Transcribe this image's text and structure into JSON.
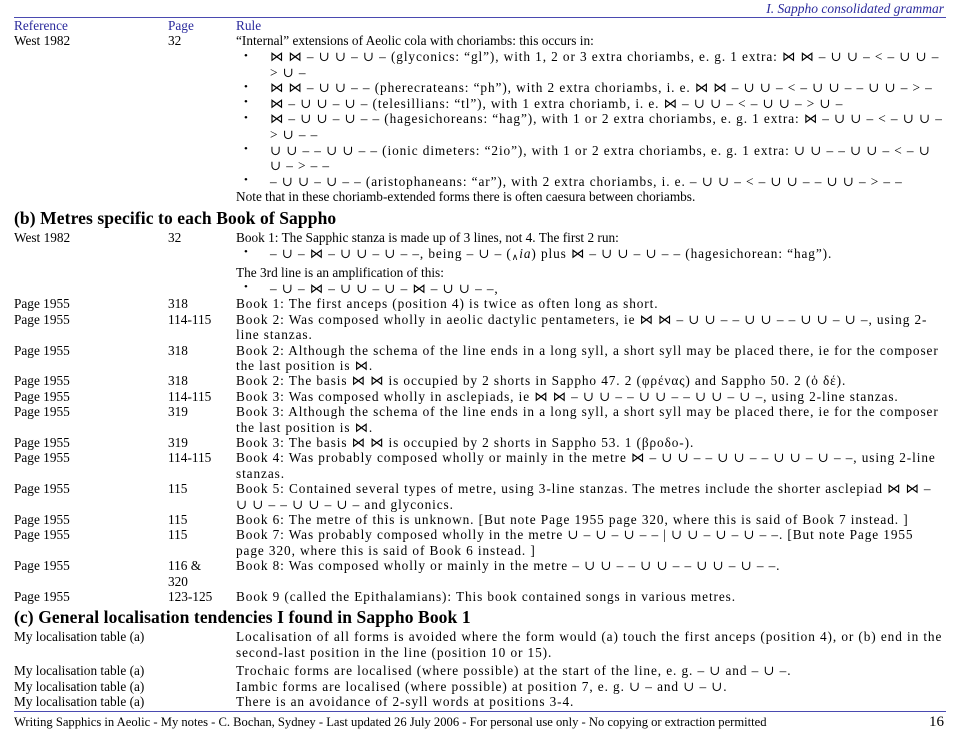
{
  "header": {
    "running_title": "I.  Sappho consolidated grammar",
    "accent_color": "#2a2a9c"
  },
  "table": {
    "columns": {
      "reference": "Reference",
      "page": "Page",
      "rule": "Rule"
    }
  },
  "sections": [
    {
      "id": "section-a-rows",
      "rows": [
        {
          "reference": "West 1982",
          "page": "32",
          "rule_intro": "“Internal” extensions of Aeolic cola with choriambs: this occurs in:",
          "bullets": [
            "⋈ ⋈ – ∪ ∪ – ∪ – (glyconics: “gl”), with 1, 2 or 3 extra choriambs, e. g.  1 extra: ⋈ ⋈ – ∪ ∪ – < – ∪ ∪ – > ∪ –",
            "⋈ ⋈ – ∪ ∪ – – (pherecrateans: “ph”), with 2 extra choriambs,  i. e. ⋈ ⋈ – ∪ ∪ – < – ∪ ∪ – – ∪ ∪ – > –",
            "⋈ – ∪ ∪ – ∪ – (telesillians: “tl”), with 1 extra choriamb, i. e. ⋈ – ∪ ∪ – < – ∪ ∪ – > ∪ –",
            "⋈ – ∪ ∪ – ∪ – – (hagesichoreans: “hag”), with 1 or 2 extra choriambs, e. g.  1 extra: ⋈ – ∪ ∪ – < – ∪ ∪ – > ∪ – –",
            "∪ ∪ – – ∪ ∪ – – (ionic dimeters: “2io”), with 1 or 2 extra choriambs, e. g.  1 extra: ∪ ∪ – – ∪ ∪ – < – ∪ ∪ – > – –",
            "– ∪ ∪ – ∪ – – (aristophaneans: “ar”), with 2 extra choriambs, i. e.  – ∪ ∪ – < – ∪ ∪ – – ∪ ∪ – > – –"
          ],
          "note": "Note that in these choriamb-extended forms there is often caesura between choriambs."
        }
      ]
    }
  ],
  "section_b": {
    "heading": "(b) Metres specific to each Book of Sappho",
    "rows": [
      {
        "reference": "West 1982",
        "page": "32",
        "rule_intro": "Book 1: The Sapphic stanza is made up of 3 lines, not 4.   The first 2 run:",
        "bullet1_pre": "– ∪ – ⋈ – ∪ ∪ – ∪ – –, being – ∪ – (",
        "bullet1_sub": "∧",
        "bullet1_ital": "ia",
        "bullet1_post": ") plus ⋈ – ∪ ∪ – ∪ – – (hagesichorean: “hag”).",
        "mid_text": "The 3rd line is an amplification of this:",
        "bullet2": "– ∪ – ⋈ – ∪ ∪ – ∪ – ⋈ – ∪ ∪ – –,"
      },
      {
        "reference": "Page 1955",
        "page": "318",
        "rule": "Book 1: The first anceps (position 4) is twice as often long as short."
      },
      {
        "reference": "Page 1955",
        "page": "114-115",
        "rule": "Book 2: Was composed wholly in aeolic dactylic pentameters, ie ⋈ ⋈ – ∪ ∪ – – ∪ ∪ – – ∪ ∪ – ∪ –, using 2-line stanzas."
      },
      {
        "reference": "Page 1955",
        "page": "318",
        "rule": "Book 2: Although the schema of the line ends in a long syll, a short syll may be placed there, ie for the composer the last position is ⋈."
      },
      {
        "reference": "Page 1955",
        "page": "318",
        "rule": "Book 2: The basis ⋈ ⋈ is occupied by 2 shorts in Sappho 47. 2 (φρένας) and Sappho 50. 2 (ὁ δέ)."
      },
      {
        "reference": "Page 1955",
        "page": "114-115",
        "rule": "Book 3: Was composed wholly in asclepiads, ie ⋈ ⋈ – ∪ ∪ – – ∪ ∪ – – ∪ ∪ – ∪ –, using 2-line stanzas."
      },
      {
        "reference": "Page 1955",
        "page": "319",
        "rule": "Book 3: Although the schema of the line ends in a long syll, a short syll may be placed there, ie for the composer the last position is ⋈."
      },
      {
        "reference": "Page 1955",
        "page": "319",
        "rule": "Book 3: The basis ⋈ ⋈ is occupied by 2 shorts in Sappho 53. 1 (βροδο-)."
      },
      {
        "reference": "Page 1955",
        "page": "114-115",
        "rule": "Book 4: Was probably composed wholly or mainly in the metre ⋈ – ∪ ∪ – – ∪ ∪ – – ∪ ∪ – ∪ – –, using 2-line stanzas."
      },
      {
        "reference": "Page 1955",
        "page": "115",
        "rule": "Book 5: Contained several types of metre, using 3-line stanzas.   The metres include the shorter asclepiad ⋈ ⋈ – ∪ ∪ – – ∪ ∪ – ∪ – and glyconics."
      },
      {
        "reference": "Page 1955",
        "page": "115",
        "rule": "Book 6: The metre of this is unknown. [But note Page 1955 page 320, where this is said of Book 7 instead. ]"
      },
      {
        "reference": "Page 1955",
        "page": "115",
        "rule": "Book 7: Was probably composed wholly in the metre ∪ – ∪ – ∪ – – | ∪ ∪ – ∪ – ∪ – –. [But note Page 1955 page 320, where this is said of Book 6 instead. ]"
      },
      {
        "reference": "Page 1955",
        "page": "116 &",
        "page2": "320",
        "rule": "Book 8: Was composed wholly or mainly in the metre – ∪ ∪ – – ∪ ∪ – – ∪ ∪ – ∪ – –."
      },
      {
        "reference": "Page 1955",
        "page": "123-125",
        "rule": "Book 9 (called the Epithalamians): This book contained songs in various metres."
      }
    ]
  },
  "section_c": {
    "heading": "(c) General localisation tendencies I found in Sappho Book 1",
    "rows": [
      {
        "reference": "My localisation table (a)",
        "page": "",
        "rule": "Localisation of all forms is avoided where the form would (a) touch the first anceps (position 4), or (b) end in the second-last position in the line (position 10 or 15)."
      },
      {
        "reference": "My localisation table (a)",
        "page": "",
        "rule": "Trochaic forms are localised (where possible) at the start of the line, e. g.  – ∪ and – ∪ –."
      },
      {
        "reference": "My localisation table (a)",
        "page": "",
        "rule": "Iambic forms are localised (where possible) at position 7, e. g.  ∪ – and ∪ – ∪."
      },
      {
        "reference": "My localisation table (a)",
        "page": "",
        "rule": "There is an avoidance of 2-syll words at positions 3-4."
      }
    ]
  },
  "footer": {
    "text": "Writing Sapphics in Aeolic - My notes - C. Bochan,  Sydney - Last updated 26 July 2006 - For personal use only - No copying or extraction permitted",
    "page_number": "16"
  }
}
